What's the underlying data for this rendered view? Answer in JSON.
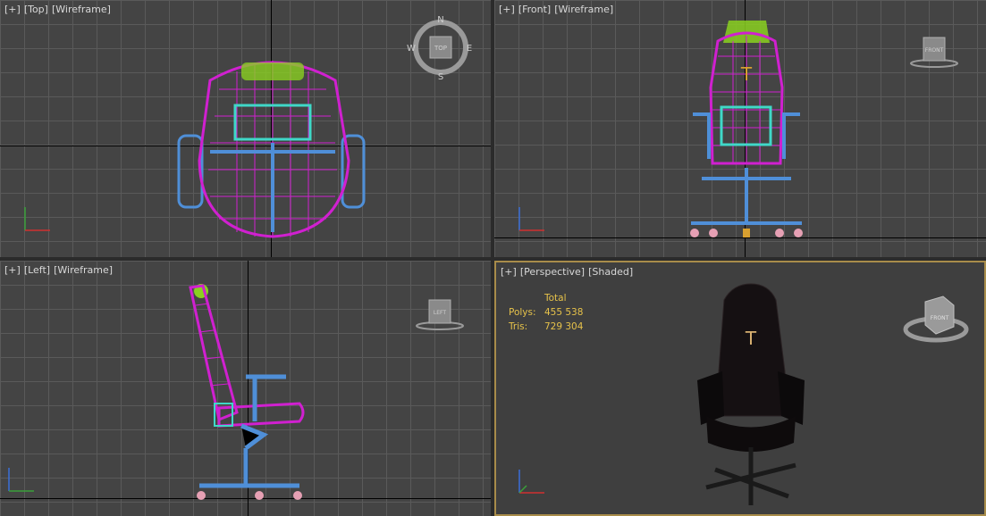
{
  "viewports": {
    "top": {
      "plus": "[+]",
      "view": "[Top]",
      "mode": "[Wireframe]"
    },
    "front": {
      "plus": "[+]",
      "view": "[Front]",
      "mode": "[Wireframe]"
    },
    "left": {
      "plus": "[+]",
      "view": "[Left]",
      "mode": "[Wireframe]"
    },
    "perspective": {
      "plus": "[+]",
      "view": "[Perspective]",
      "mode": "[Shaded]"
    }
  },
  "stats": {
    "header": "Total",
    "polys_label": "Polys:",
    "polys_value": "455 538",
    "tris_label": "Tris:",
    "tris_value": "729 304"
  },
  "compass": {
    "n": "N",
    "s": "S",
    "e": "E",
    "w": "W"
  },
  "viewcube": {
    "top": "TOP",
    "front": "FRONT",
    "left": "LEFT"
  },
  "colors": {
    "accent_border": "#a88c4a",
    "stats_text": "#e6c24a",
    "wire_magenta": "#d020d0",
    "wire_blue": "#4f8fd8",
    "wire_cyan": "#3fd8c8",
    "wire_green": "#8ad020",
    "wire_pink": "#e6a0b4"
  }
}
